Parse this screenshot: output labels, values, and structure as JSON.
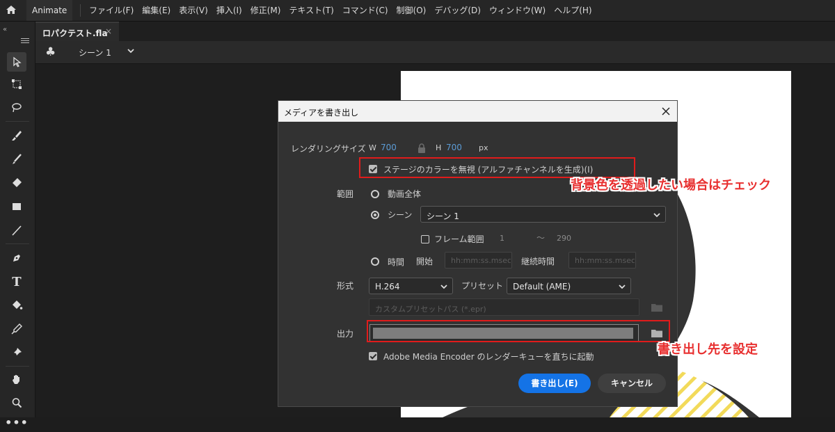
{
  "menubar": {
    "app_name": "Animate",
    "items": [
      "ファイル(F)",
      "編集(E)",
      "表示(V)",
      "挿入(I)",
      "修正(M)",
      "テキスト(T)",
      "コマンド(C)",
      "制御(O)",
      "デバッグ(D)",
      "ウィンドウ(W)",
      "ヘルプ(H)"
    ]
  },
  "document_tab": {
    "name": "ロパクテスト.fla",
    "close": "×"
  },
  "scenebar": {
    "scene_name": "シーン 1"
  },
  "dialog": {
    "title": "メディアを書き出し",
    "render_size_label": "レンダリングサイズ",
    "w_label": "W",
    "w_value": "700",
    "h_label": "H",
    "h_value": "700",
    "unit": "px",
    "ignore_stage_color_label": "ステージのカラーを無視 (アルファチャンネルを生成)(I)",
    "range_label": "範囲",
    "range_entire_movie": "動画全体",
    "range_scene": "シーン",
    "scene_select_value": "シーン 1",
    "frame_range_label": "フレーム範囲",
    "frame_start": "1",
    "frame_tilde": "〜",
    "frame_end": "290",
    "range_time": "時間",
    "start_label": "開始",
    "start_placeholder": "hh:mm:ss.msec",
    "duration_label": "継続時間",
    "duration_placeholder": "hh:mm:ss.msec",
    "format_label": "形式",
    "format_value": "H.264",
    "preset_label": "プリセット",
    "preset_value": "Default (AME)",
    "custom_preset_placeholder": "カスタムプリセットパス (*.epr)",
    "output_label": "出力",
    "ame_label": "Adobe Media Encoder のレンダーキューを直ちに起動",
    "export_button": "書き出し(E)",
    "cancel_button": "キャンセル"
  },
  "annotations": {
    "bg_note": "背景色を透過したい場合はチェック",
    "output_note": "書き出し先を設定"
  },
  "colors": {
    "accent": "#1473e6",
    "annotation": "#e11b1b"
  }
}
